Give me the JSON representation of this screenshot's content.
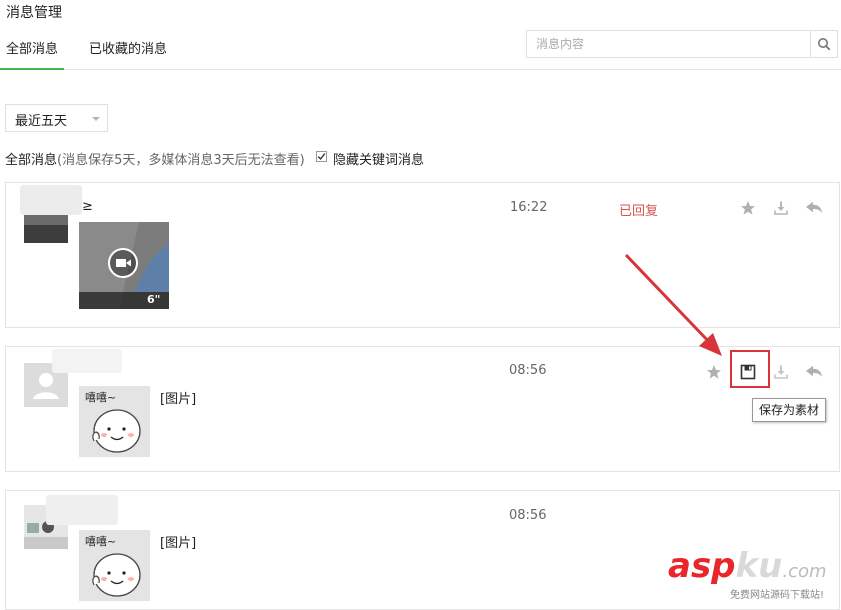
{
  "page": {
    "title": "消息管理"
  },
  "tabs": [
    {
      "label": "全部消息",
      "active": true
    },
    {
      "label": "已收藏的消息",
      "active": false
    }
  ],
  "search": {
    "placeholder": "消息内容",
    "icon": "search-icon"
  },
  "filter": {
    "selected": "最近五天"
  },
  "info": {
    "label": "全部消息",
    "note": "(消息保存5天，多媒体消息3天后无法查看)",
    "hide_keyword_label": "隐藏关键词消息",
    "hide_keyword_checked": true
  },
  "messages": [
    {
      "name_fragment": "≥",
      "time": "16:22",
      "status": "已回复",
      "media": "video",
      "duration": "6\""
    },
    {
      "time": "08:56",
      "image_label": "[图片]"
    },
    {
      "time": "08:56",
      "image_label": "[图片]"
    }
  ],
  "sticker_text": "嘻嘻~",
  "tooltip": {
    "text": "保存为素材"
  },
  "watermark": {
    "brand_a": "asp",
    "brand_b": "ku",
    "brand_c": ".com",
    "slogan": "免费网站源码下载站!"
  },
  "colors": {
    "accent": "#44b549",
    "status": "#d9534f",
    "highlight": "#d8343a",
    "brand_red": "#e8262c"
  }
}
